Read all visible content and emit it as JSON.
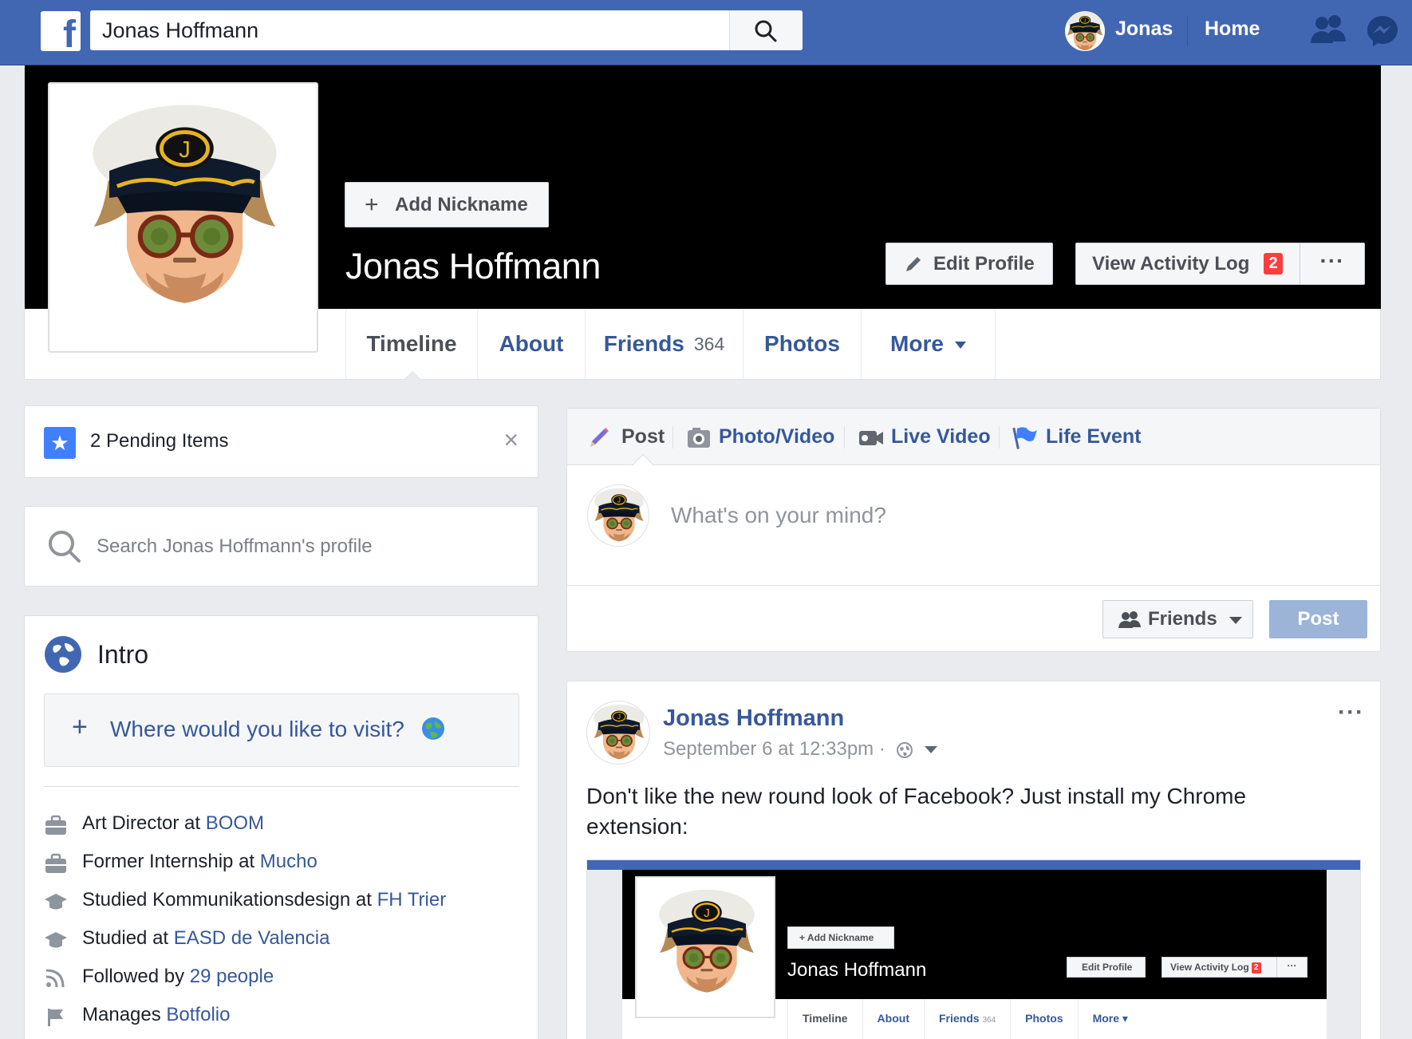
{
  "topbar": {
    "logo_letter": "f",
    "search_value": "Jonas Hoffmann",
    "user_name": "Jonas",
    "home_label": "Home"
  },
  "profile": {
    "add_nickname_label": "Add Nickname",
    "name": "Jonas Hoffmann",
    "edit_profile_label": "Edit Profile",
    "activity_log_label": "View Activity Log",
    "activity_log_badge": "2",
    "more_dots": "···",
    "tabs": [
      {
        "label": "Timeline",
        "active": true
      },
      {
        "label": "About"
      },
      {
        "label": "Friends",
        "count": "364"
      },
      {
        "label": "Photos"
      },
      {
        "label": "More"
      }
    ]
  },
  "left": {
    "pending_text": "2 Pending Items",
    "close_glyph": "×",
    "search_placeholder": "Search Jonas Hoffmann's profile",
    "intro_title": "Intro",
    "visit_prompt": "Where would you like to visit?",
    "intro_items": [
      {
        "icon": "briefcase-icon",
        "prefix": "Art Director at ",
        "link": "BOOM"
      },
      {
        "icon": "briefcase-icon",
        "prefix": "Former Internship at ",
        "link": "Mucho"
      },
      {
        "icon": "graduation-cap-icon",
        "prefix": "Studied Kommunikationsdesign at ",
        "link": "FH Trier"
      },
      {
        "icon": "graduation-cap-icon",
        "prefix": "Studied at ",
        "link": "EASD de Valencia"
      },
      {
        "icon": "rss-icon",
        "prefix": "Followed by ",
        "link": "29 people"
      },
      {
        "icon": "flag-icon",
        "prefix": "Manages ",
        "link": "Botfolio"
      }
    ]
  },
  "composer": {
    "tabs": {
      "post": "Post",
      "photo_video": "Photo/Video",
      "live_video": "Live Video",
      "life_event": "Life Event"
    },
    "placeholder": "What's on your mind?",
    "audience_label": "Friends",
    "post_button": "Post"
  },
  "feed": {
    "author": "Jonas Hoffmann",
    "timestamp": "September 6 at 12:33pm ·",
    "options": "···",
    "text": "Don't like the new round look of Facebook? Just install my Chrome extension:",
    "embed": {
      "add_nickname": "+ Add Nickname",
      "name": "Jonas Hoffmann",
      "edit_profile": "Edit Profile",
      "activity_log": "View Activity Log",
      "badge": "2",
      "dots": "···",
      "tabs": [
        "Timeline",
        "About",
        "Friends",
        "Photos",
        "More ▾"
      ],
      "friends_count": "364"
    }
  },
  "colors": {
    "brand_blue": "#4267b2",
    "link_blue": "#365899",
    "badge_red": "#fa3e3e",
    "post_button_disabled": "#9cb4d8"
  }
}
